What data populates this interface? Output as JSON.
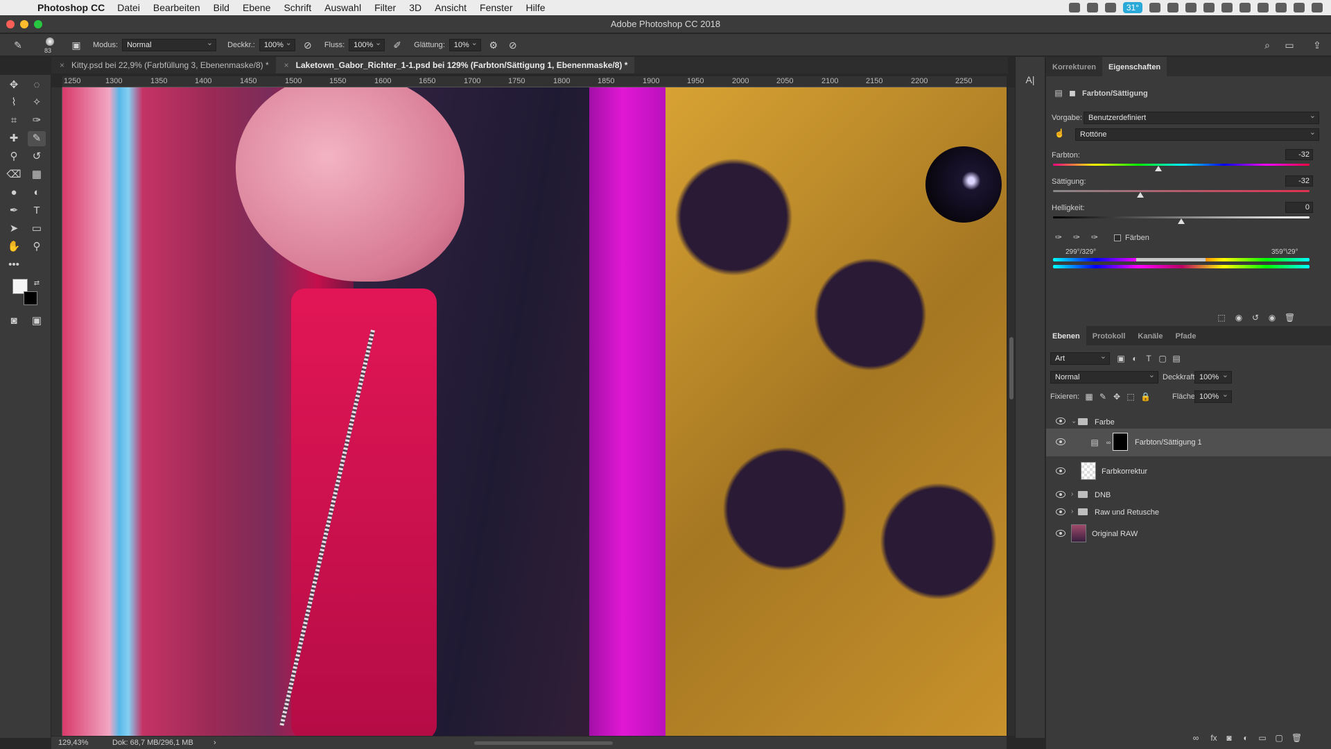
{
  "menubar": {
    "app": "Photoshop CC",
    "items": [
      "Datei",
      "Bearbeiten",
      "Bild",
      "Ebene",
      "Schrift",
      "Auswahl",
      "Filter",
      "3D",
      "Ansicht",
      "Fenster",
      "Hilfe"
    ],
    "battery": "31°"
  },
  "window": {
    "title": "Adobe Photoshop CC 2018"
  },
  "options": {
    "brush_size": "83",
    "mode_label": "Modus:",
    "mode_value": "Normal",
    "opacity_label": "Deckkr.:",
    "opacity_value": "100%",
    "flow_label": "Fluss:",
    "flow_value": "100%",
    "smoothing_label": "Glättung:",
    "smoothing_value": "10%"
  },
  "tabs": [
    {
      "label": "Kitty.psd bei 22,9% (Farbfüllung 3, Ebenenmaske/8) *"
    },
    {
      "label": "Laketown_Gabor_Richter_1-1.psd bei 129% (Farbton/Sättigung 1, Ebenenmaske/8) *"
    }
  ],
  "ruler": {
    "ticks": [
      "1250",
      "1300",
      "1350",
      "1400",
      "1450",
      "1500",
      "1550",
      "1600",
      "1650",
      "1700",
      "1750",
      "1800",
      "1850",
      "1900",
      "1950",
      "2000",
      "2050",
      "2100",
      "2150",
      "2200",
      "2250"
    ]
  },
  "status": {
    "zoom": "129,43%",
    "doc": "Dok: 68,7 MB/296,1 MB",
    "arrow": "›"
  },
  "properties": {
    "tab_corrections": "Korrekturen",
    "tab_properties": "Eigenschaften",
    "title": "Farbton/Sättigung",
    "preset_label": "Vorgabe:",
    "preset_value": "Benutzerdefiniert",
    "range_value": "Rottöne",
    "hue_label": "Farbton:",
    "hue_value": "-32",
    "hue_level": 0.41,
    "sat_label": "Sättigung:",
    "sat_value": "-32",
    "sat_level": 0.34,
    "light_label": "Helligkeit:",
    "light_value": "0",
    "light_level": 0.5,
    "colorize_label": "Färben",
    "range_left": "299°/329°",
    "range_right": "359°\\29°"
  },
  "layers_panel": {
    "tabs": [
      "Ebenen",
      "Protokoll",
      "Kanäle",
      "Pfade"
    ],
    "filter_label": "Art",
    "blend_value": "Normal",
    "opacity_label": "Deckkraft:",
    "opacity_value": "100%",
    "lock_label": "Fixieren:",
    "fill_label": "Fläche:",
    "fill_value": "100%",
    "layers": [
      {
        "name": "Farbe"
      },
      {
        "name": "Farbton/Sättigung 1"
      },
      {
        "name": "Farbkorrektur"
      },
      {
        "name": "DNB"
      },
      {
        "name": "Raw und Retusche"
      },
      {
        "name": "Original RAW"
      }
    ]
  }
}
